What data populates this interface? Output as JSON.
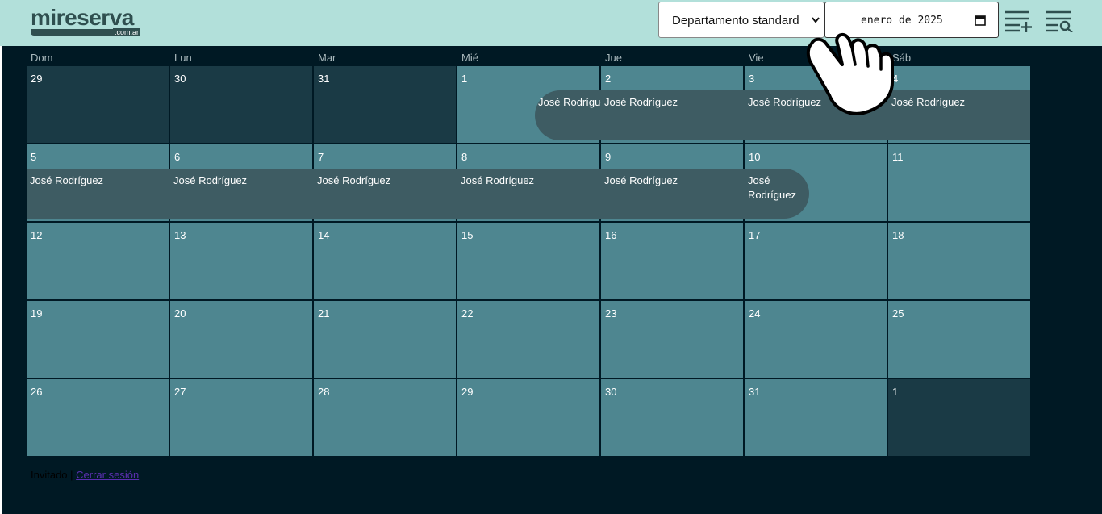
{
  "brand": {
    "name": "mireserva",
    "suffix": ".com.ar"
  },
  "filters": {
    "property_select": "Departamento standard",
    "month_value": "enero de 2025"
  },
  "toolbar_icons": [
    "add-list-icon",
    "search-list-icon"
  ],
  "weekdays": [
    "Dom",
    "Lun",
    "Mar",
    "Mié",
    "Jue",
    "Vie",
    "Sáb"
  ],
  "weeks": [
    [
      "29",
      "30",
      "31",
      "1",
      "2",
      "3",
      "4"
    ],
    [
      "5",
      "6",
      "7",
      "8",
      "9",
      "10",
      "11"
    ],
    [
      "12",
      "13",
      "14",
      "15",
      "16",
      "17",
      "18"
    ],
    [
      "19",
      "20",
      "21",
      "22",
      "23",
      "24",
      "25"
    ],
    [
      "26",
      "27",
      "28",
      "29",
      "30",
      "31",
      "1"
    ]
  ],
  "outside_month_cells": [
    [
      0,
      0
    ],
    [
      0,
      1
    ],
    [
      0,
      2
    ],
    [
      4,
      6
    ]
  ],
  "reservations": [
    {
      "guest": "José Rodríguez",
      "week": 0,
      "from_day": 3,
      "to_day": 6
    },
    {
      "guest": "José Rodríguez",
      "week": 1,
      "from_day": 0,
      "to_day": 5
    }
  ],
  "footer": {
    "user": "Invitado",
    "separator": " | ",
    "logout": "Cerrar sesión"
  },
  "colors": {
    "header_bg": "#b2e0da",
    "page_bg": "#001924",
    "cell_bg": "#4e8690",
    "cell_outside_bg": "#1a3a45",
    "event_bg": "#3e5c63"
  }
}
